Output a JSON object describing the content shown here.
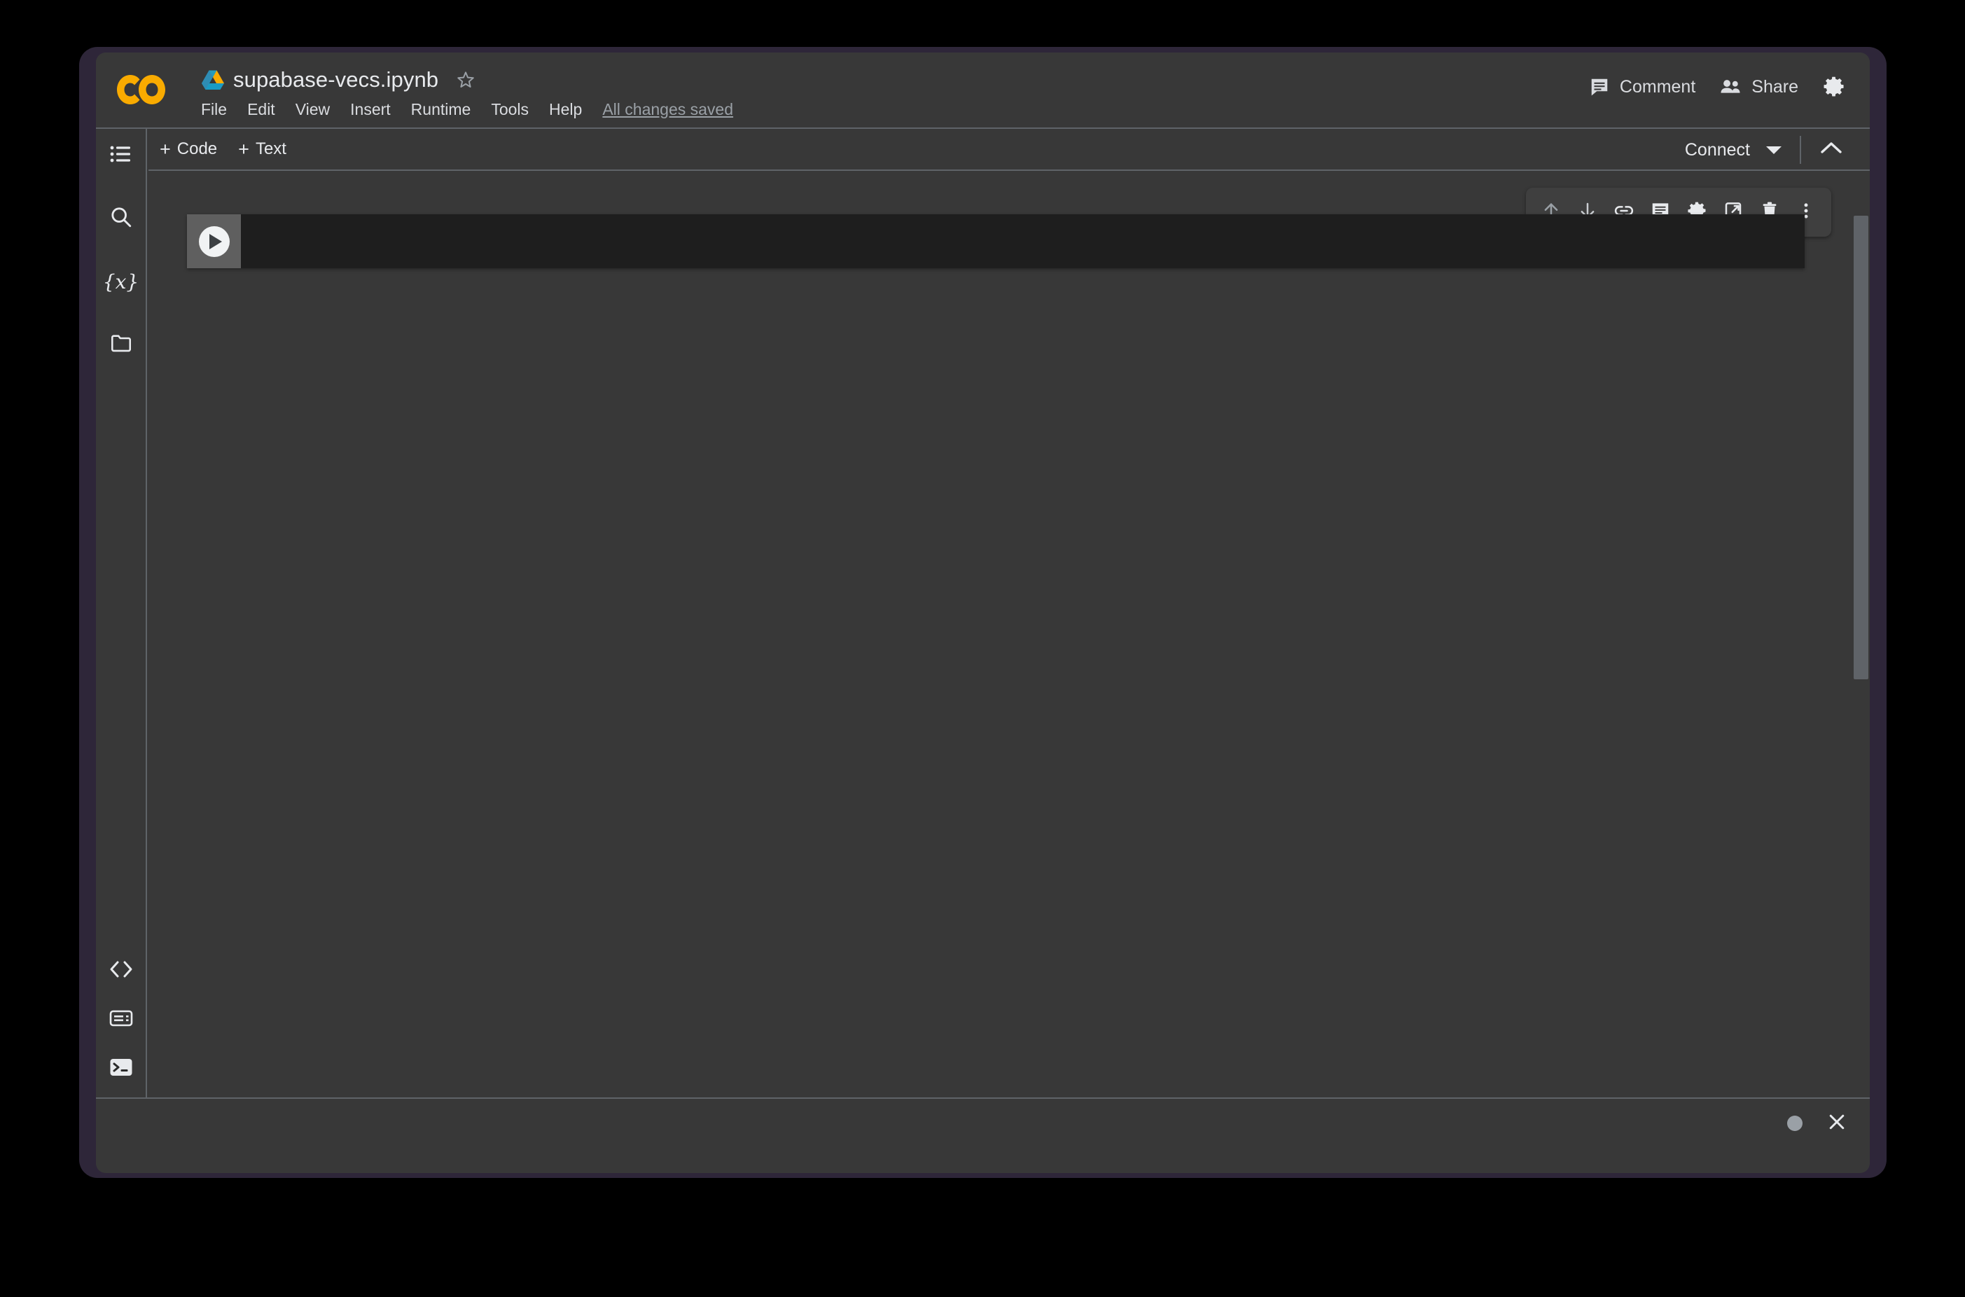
{
  "app": {
    "name": "Google Colab",
    "logo_text": "CO"
  },
  "header": {
    "drive_icon": "drive-icon",
    "doc_title": "supabase-vecs.ipynb",
    "star_icon": "star-icon",
    "menus": [
      {
        "label": "File"
      },
      {
        "label": "Edit"
      },
      {
        "label": "View"
      },
      {
        "label": "Insert"
      },
      {
        "label": "Runtime"
      },
      {
        "label": "Tools"
      },
      {
        "label": "Help"
      }
    ],
    "save_status": "All changes saved",
    "actions": [
      {
        "label": "Comment",
        "icon": "comment-icon"
      },
      {
        "label": "Share",
        "icon": "people-icon"
      }
    ],
    "settings_icon": "gear-icon"
  },
  "toolbar": {
    "add_code_label": "Code",
    "add_text_label": "Text",
    "plus_glyph": "+",
    "connect_label": "Connect",
    "connect_caret_icon": "chevron-down-icon",
    "collapse_icon": "chevron-up-icon"
  },
  "sidebar": {
    "top_items": [
      {
        "name": "table-of-contents",
        "icon": "list-icon"
      },
      {
        "name": "find-and-replace",
        "icon": "search-icon"
      },
      {
        "name": "variables",
        "icon": "variables-icon",
        "glyph": "{x}"
      },
      {
        "name": "files",
        "icon": "folder-icon"
      }
    ],
    "bottom_items": [
      {
        "name": "code-snippets",
        "icon": "code-brackets-icon"
      },
      {
        "name": "command-palette",
        "icon": "command-palette-icon"
      },
      {
        "name": "terminal",
        "icon": "terminal-icon"
      }
    ]
  },
  "notebook": {
    "cells": [
      {
        "type": "code",
        "run_button_icon": "play-icon",
        "source": "",
        "actions": [
          {
            "name": "move-cell-up",
            "icon": "arrow-up-icon"
          },
          {
            "name": "move-cell-down",
            "icon": "arrow-down-icon"
          },
          {
            "name": "link-to-cell",
            "icon": "link-icon"
          },
          {
            "name": "add-comment",
            "icon": "comment-icon"
          },
          {
            "name": "cell-settings",
            "icon": "gear-icon"
          },
          {
            "name": "mirror-cell-in-tab",
            "icon": "popout-icon"
          },
          {
            "name": "delete-cell",
            "icon": "trash-icon"
          },
          {
            "name": "more-cell-actions",
            "icon": "more-vertical-icon"
          }
        ]
      }
    ]
  },
  "status_bar": {
    "indicator": "idle-dot",
    "close_icon": "close-icon"
  },
  "colors": {
    "brand_orange": "#F9AB00",
    "surface": "#383838",
    "cell_background": "#1E1E1E",
    "divider": "#5F6368",
    "text_primary": "#E8EAED",
    "text_secondary": "#9AA0A6",
    "window_frame": "#2E2639",
    "gutter": "#5F5F5F"
  }
}
